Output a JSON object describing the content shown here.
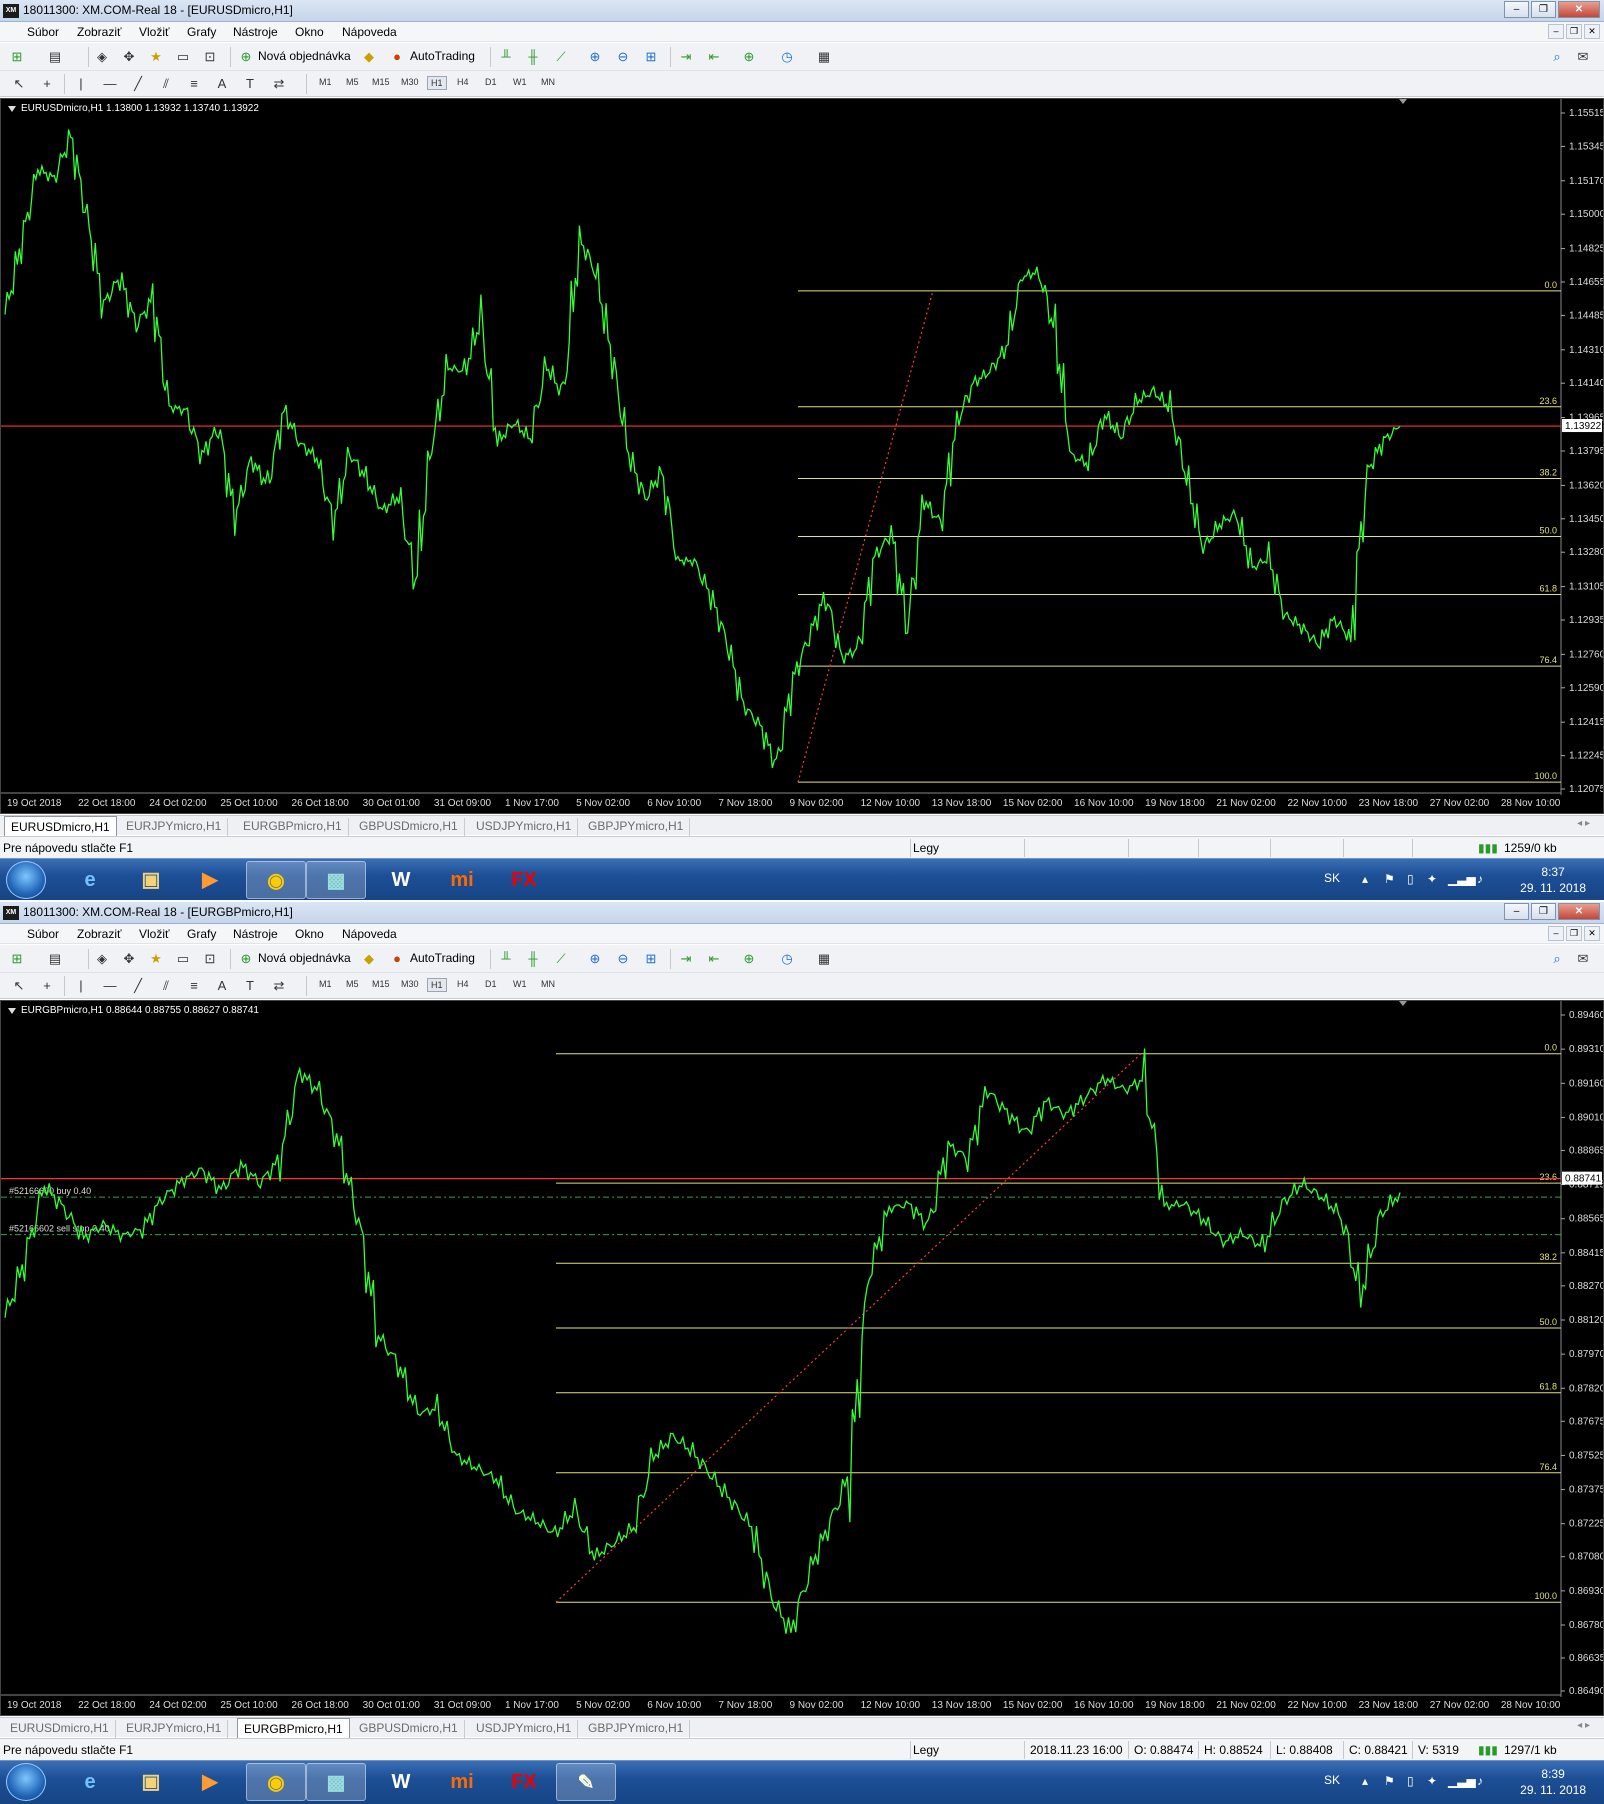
{
  "colors": {
    "bg": "#000000",
    "price_line": "#33ff33",
    "fib": "#e2e27a",
    "current": "#ff3030",
    "trend": "#ff3b3b",
    "order": "#2aa845",
    "axis_text": "#dddddd"
  },
  "menus": [
    "Súbor",
    "Zobraziť",
    "Vložiť",
    "Grafy",
    "Nástroje",
    "Okno",
    "Nápoveda"
  ],
  "toolbar": {
    "new_order": "Nová objednávka",
    "autotrading": "AutoTrading",
    "timeframes": [
      "M1",
      "M5",
      "M15",
      "M30",
      "H1",
      "H4",
      "D1",
      "W1",
      "MN"
    ],
    "active_tf": "H1"
  },
  "tabs": [
    "EURUSDmicro,H1",
    "EURJPYmicro,H1",
    "EURGBPmicro,H1",
    "GBPUSDmicro,H1",
    "USDJPYmicro,H1",
    "GBPJPYmicro,H1"
  ],
  "x_axis_labels": [
    "19 Oct 2018",
    "22 Oct 18:00",
    "24 Oct 02:00",
    "25 Oct 10:00",
    "26 Oct 18:00",
    "30 Oct 01:00",
    "31 Oct 09:00",
    "1 Nov 17:00",
    "5 Nov 02:00",
    "6 Nov 10:00",
    "7 Nov 18:00",
    "9 Nov 02:00",
    "12 Nov 10:00",
    "13 Nov 18:00",
    "15 Nov 02:00",
    "16 Nov 10:00",
    "19 Nov 18:00",
    "21 Nov 02:00",
    "22 Nov 10:00",
    "23 Nov 18:00",
    "27 Nov 02:00",
    "28 Nov 10:00"
  ],
  "fib_levels": [
    "0.0",
    "23.6",
    "38.2",
    "50.0",
    "61.8",
    "76.4",
    "100.0"
  ],
  "top": {
    "title": "18011300: XM.COM-Real 18 - [EURUSDmicro,H1]",
    "chart_header": "EURUSDmicro,H1  1.13800 1.13932 1.13740 1.13922",
    "current_price": "1.13922",
    "y_ticks": [
      "1.15515",
      "1.15345",
      "1.15170",
      "1.15000",
      "1.14825",
      "1.14655",
      "1.14485",
      "1.14310",
      "1.14140",
      "1.13965",
      "1.13795",
      "1.13620",
      "1.13450",
      "1.13280",
      "1.13105",
      "1.12935",
      "1.12760",
      "1.12590",
      "1.12415",
      "1.12245",
      "1.12075"
    ],
    "active_tab": "EURUSDmicro,H1",
    "status": {
      "help": "Pre nápovedu stlačte F1",
      "profile": "Legy",
      "traffic": "1259/0 kb"
    },
    "clock_time": "8:37",
    "clock_date": "29. 11. 2018",
    "lang": "SK"
  },
  "bottom": {
    "title": "18011300: XM.COM-Real 18 - [EURGBPmicro,H1]",
    "chart_header": "EURGBPmicro,H1  0.88644 0.88755 0.88627 0.88741",
    "current_price": "0.88741",
    "y_ticks": [
      "0.89460",
      "0.89310",
      "0.89160",
      "0.89010",
      "0.88865",
      "0.88715",
      "0.88565",
      "0.88415",
      "0.88270",
      "0.88120",
      "0.87970",
      "0.87820",
      "0.87675",
      "0.87525",
      "0.87375",
      "0.87225",
      "0.87080",
      "0.86930",
      "0.86780",
      "0.86635",
      "0.86490"
    ],
    "orders": [
      {
        "label": "#52166600 buy 0.40"
      },
      {
        "label": "#52166602 sell stop 0.40"
      }
    ],
    "active_tab": "EURGBPmicro,H1",
    "status": {
      "help": "Pre nápovedu stlačte F1",
      "profile": "Legy",
      "datetime": "2018.11.23 16:00",
      "open": "O: 0.88474",
      "high": "H: 0.88524",
      "low": "L: 0.88408",
      "close": "C: 0.88421",
      "volume": "V: 5319",
      "traffic": "1297/1 kb"
    },
    "clock_time": "8:39",
    "clock_date": "29. 11. 2018",
    "lang": "SK"
  },
  "chart_data": [
    {
      "type": "line",
      "title": "EURUSDmicro,H1",
      "ylim": [
        1.12075,
        1.15515
      ],
      "series": [
        {
          "values": [
            1.1449,
            1.1485,
            1.1523,
            1.1518,
            1.154,
            1.1498,
            1.1454,
            1.1468,
            1.1443,
            1.1457,
            1.1402,
            1.14,
            1.1377,
            1.1392,
            1.1345,
            1.1375,
            1.1362,
            1.14,
            1.1383,
            1.1376,
            1.1343,
            1.1378,
            1.1366,
            1.1349,
            1.1357,
            1.1313,
            1.1383,
            1.1422,
            1.142,
            1.1447,
            1.1384,
            1.1394,
            1.1386,
            1.1423,
            1.1408,
            1.1488,
            1.147,
            1.1427,
            1.1378,
            1.1355,
            1.1369,
            1.1324,
            1.1323,
            1.1306,
            1.1282,
            1.125,
            1.124,
            1.1219,
            1.1263,
            1.1285,
            1.1306,
            1.1274,
            1.1279,
            1.1326,
            1.1337,
            1.129,
            1.1354,
            1.1343,
            1.1394,
            1.1414,
            1.142,
            1.1432,
            1.1468,
            1.1471,
            1.1439,
            1.1377,
            1.1373,
            1.1398,
            1.1387,
            1.1405,
            1.141,
            1.1401,
            1.1366,
            1.133,
            1.1342,
            1.1348,
            1.132,
            1.1325,
            1.1296,
            1.129,
            1.1281,
            1.1294,
            1.1284,
            1.1369,
            1.1385,
            1.1392
          ]
        }
      ],
      "fib_0": 1.1461,
      "fib_100": 1.1211
    },
    {
      "type": "line",
      "title": "EURGBPmicro,H1",
      "ylim": [
        0.8649,
        0.8946
      ],
      "series": [
        {
          "values": [
            0.8813,
            0.8838,
            0.8871,
            0.8861,
            0.8848,
            0.8854,
            0.8849,
            0.8852,
            0.8865,
            0.8873,
            0.8878,
            0.8869,
            0.888,
            0.8872,
            0.8883,
            0.8921,
            0.8912,
            0.8889,
            0.8855,
            0.8805,
            0.8793,
            0.8771,
            0.8773,
            0.8752,
            0.8747,
            0.8742,
            0.8728,
            0.8724,
            0.8718,
            0.8729,
            0.8708,
            0.8714,
            0.8721,
            0.8752,
            0.8761,
            0.8754,
            0.8743,
            0.8732,
            0.8721,
            0.869,
            0.8675,
            0.8703,
            0.8723,
            0.8745,
            0.8833,
            0.8861,
            0.8863,
            0.8853,
            0.8889,
            0.8883,
            0.8913,
            0.8903,
            0.8894,
            0.8908,
            0.8902,
            0.891,
            0.8918,
            0.8913,
            0.8918,
            0.8862,
            0.8863,
            0.8856,
            0.8846,
            0.885,
            0.8844,
            0.8863,
            0.8872,
            0.8866,
            0.8858,
            0.8823,
            0.8858,
            0.8868
          ]
        }
      ],
      "fib_0": 0.8929,
      "fib_100": 0.8688
    }
  ]
}
